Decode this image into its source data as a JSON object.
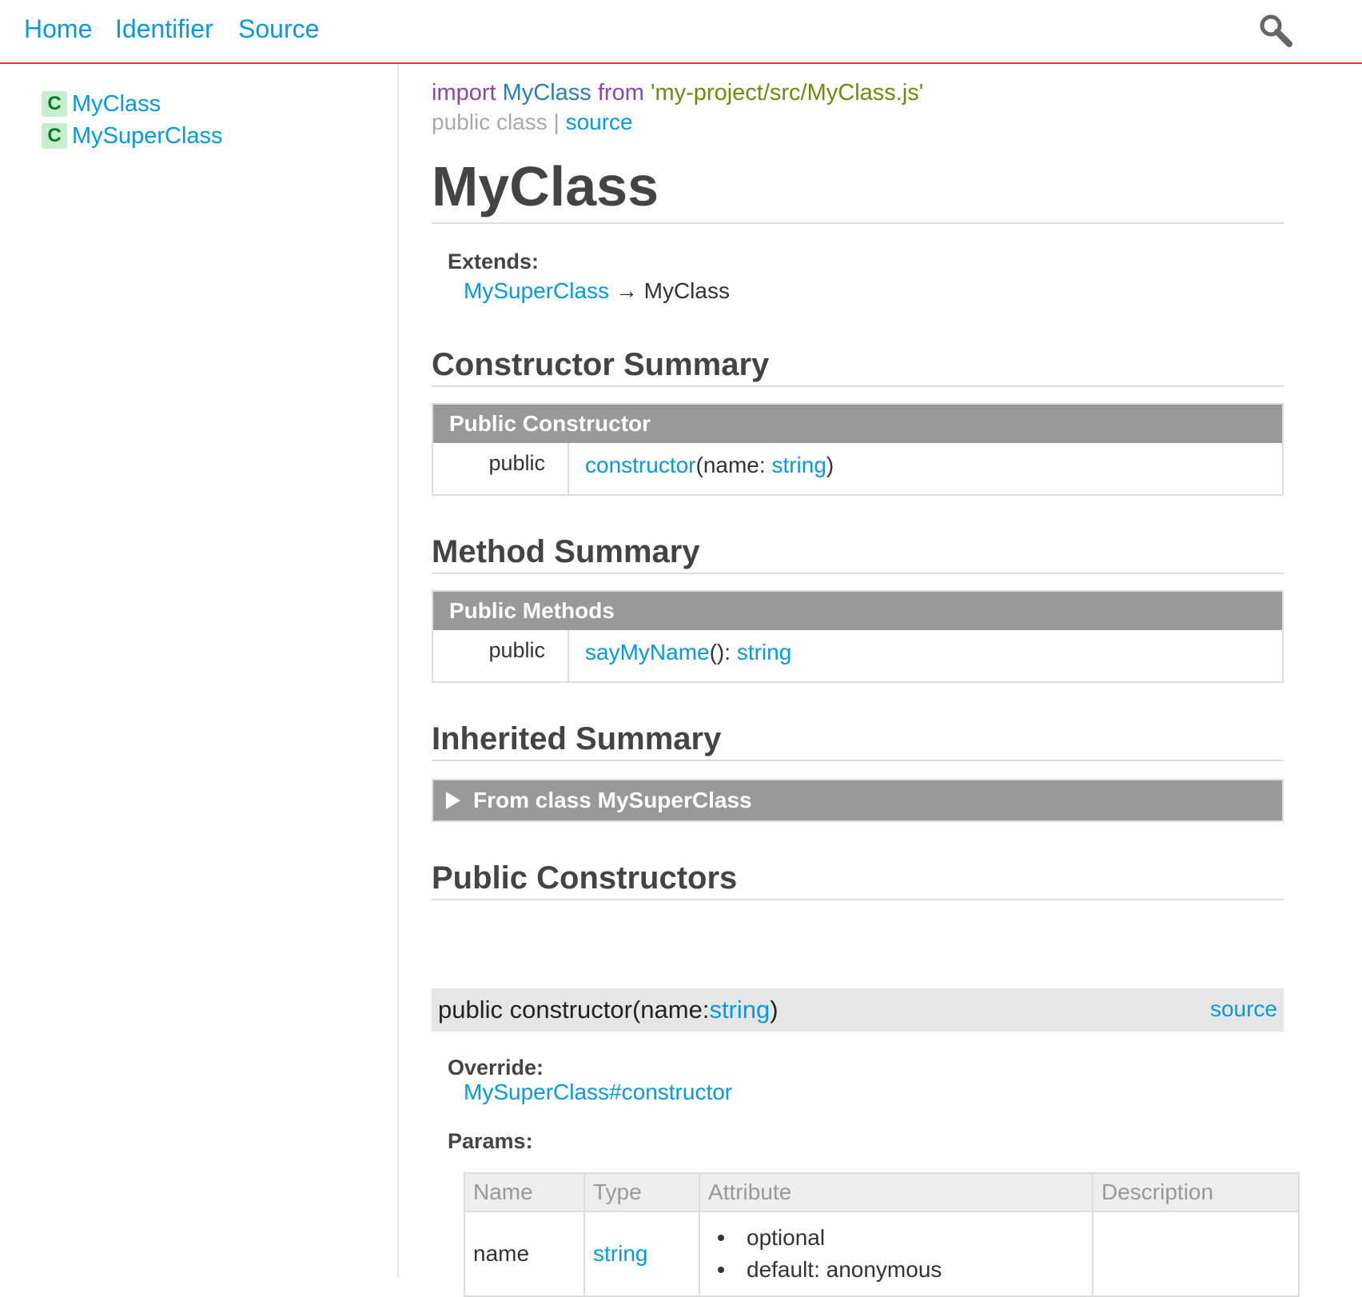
{
  "header": {
    "nav": [
      "Home",
      "Identifier",
      "Source"
    ]
  },
  "sidebar": {
    "items": [
      {
        "badge": "C",
        "label": "MyClass"
      },
      {
        "badge": "C",
        "label": "MySuperClass"
      }
    ]
  },
  "main": {
    "import": {
      "kw_import": "import",
      "name": "MyClass",
      "kw_from": "from",
      "path": "'my-project/src/MyClass.js'"
    },
    "access": {
      "text": "public class",
      "separator": "|",
      "source_link": "source"
    },
    "title": "MyClass",
    "extends": {
      "label": "Extends:",
      "parent": "MySuperClass",
      "arrow": "→",
      "self": "MyClass"
    },
    "constructor_summary": {
      "heading": "Constructor Summary",
      "table_title": "Public Constructor",
      "access": "public",
      "name": "constructor",
      "params_open": "(name: ",
      "param_type": "string",
      "params_close": ")"
    },
    "method_summary": {
      "heading": "Method Summary",
      "table_title": "Public Methods",
      "access": "public",
      "name": "sayMyName",
      "mid": "(): ",
      "return_type": "string"
    },
    "inherited_summary": {
      "heading": "Inherited Summary",
      "bar_label": "From class MySuperClass"
    },
    "public_constructors": {
      "heading": "Public Constructors",
      "signature_prefix": "public constructor(name: ",
      "signature_type": "string",
      "signature_suffix": ")",
      "source_link": "source",
      "override_label": "Override:",
      "override_link": "MySuperClass#constructor",
      "params_label": "Params:",
      "params_columns": [
        "Name",
        "Type",
        "Attribute",
        "Description"
      ],
      "params_rows": [
        {
          "name": "name",
          "type": "string",
          "attributes": [
            "optional",
            "default: anonymous"
          ],
          "description": ""
        }
      ]
    }
  }
}
